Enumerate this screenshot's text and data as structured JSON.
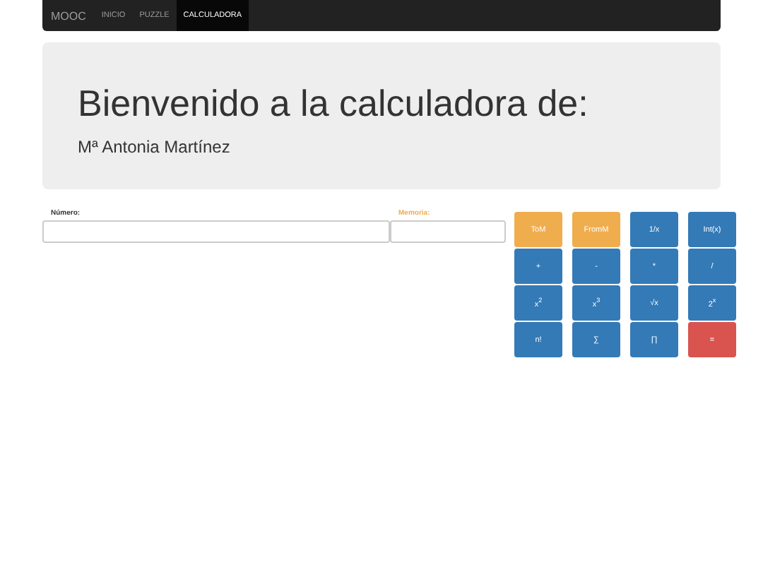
{
  "navbar": {
    "brand": "MOOC",
    "items": [
      {
        "label": "INICIO",
        "selected": false
      },
      {
        "label": "PUZZLE",
        "selected": false
      },
      {
        "label": "CALCULADORA",
        "selected": true
      }
    ]
  },
  "jumbotron": {
    "title": "Bienvenido a la calculadora de:",
    "subtitle": "Mª Antonia Martínez"
  },
  "fields": [
    {
      "label": "Número:",
      "kind": "default"
    },
    {
      "label": "Memoria:",
      "kind": "warning"
    }
  ],
  "buttons": [
    {
      "label": "ToM",
      "kind": "warning"
    },
    {
      "label": "FromM",
      "kind": "warning"
    },
    {
      "label": "1/x",
      "kind": "primary"
    },
    {
      "label": "Int(x)",
      "kind": "primary"
    },
    {
      "label": "+",
      "kind": "primary"
    },
    {
      "label": "-",
      "kind": "primary"
    },
    {
      "label": "*",
      "kind": "primary"
    },
    {
      "label": "/",
      "kind": "primary"
    },
    {
      "label": "x$^{2}$",
      "kind": "primary"
    },
    {
      "label": "x$^{3}$",
      "kind": "primary"
    },
    {
      "label": "√x",
      "kind": "primary"
    },
    {
      "label": "2$^{x}$",
      "kind": "primary"
    },
    {
      "label": "n!",
      "kind": "primary"
    },
    {
      "label": "∑",
      "kind": "primary"
    },
    {
      "label": "∏",
      "kind": "primary"
    },
    {
      "label": "=",
      "kind": "danger"
    }
  ]
}
